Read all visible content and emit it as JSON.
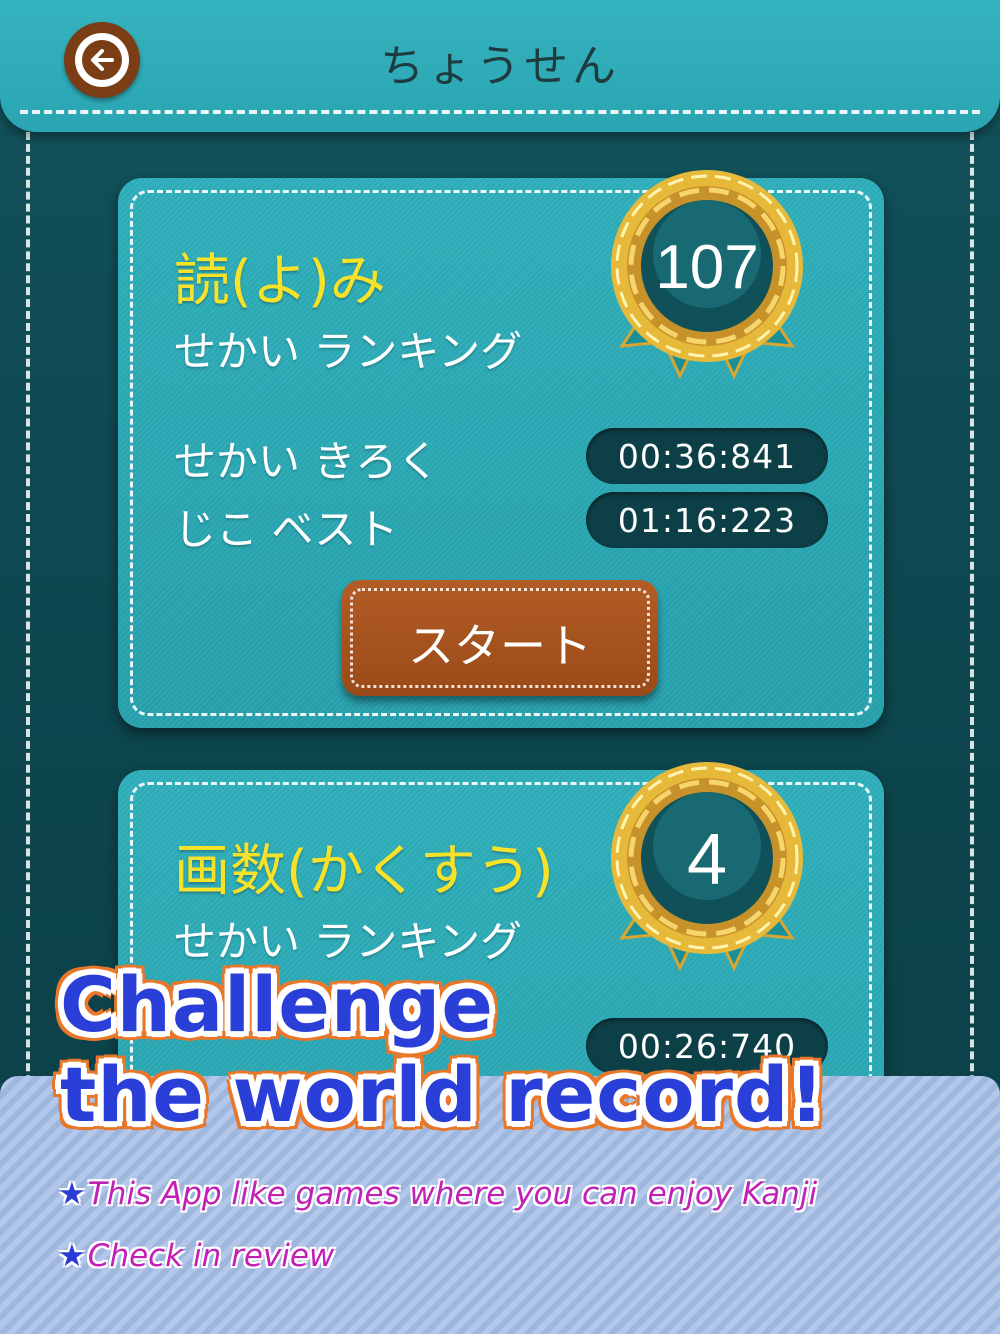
{
  "header": {
    "title": "ちょうせん",
    "back_icon": "back-arrow-icon"
  },
  "cards": [
    {
      "mode_title": "読(よ)み",
      "world_ranking_label": "せかい ランキング",
      "rank": "107",
      "world_record_label": "せかい きろく",
      "world_record_time": "00:36:841",
      "personal_best_label": "じこ ベスト",
      "personal_best_time": "01:16:223",
      "start_label": "スタート"
    },
    {
      "mode_title": "画数(かくすう)",
      "world_ranking_label": "せかい ランキング",
      "rank": "4",
      "world_record_time": "00:26:740"
    }
  ],
  "promo": {
    "headline_line1": "Challenge",
    "headline_line2": "the world record!",
    "features": [
      {
        "star": "★",
        "text": "This App like games where you can enjoy Kanji"
      },
      {
        "star": "★",
        "text": "Check in review"
      }
    ]
  },
  "colors": {
    "teal": "#2fb0bc",
    "dark_teal": "#0d3f46",
    "yellow_title": "#f7e22a",
    "button_brown": "#9a4a18",
    "medal_gold": "#e0b23a",
    "headline_blue": "#2a3fd8",
    "headline_outline": "#e8772a",
    "feature_magenta": "#c21fb5"
  }
}
